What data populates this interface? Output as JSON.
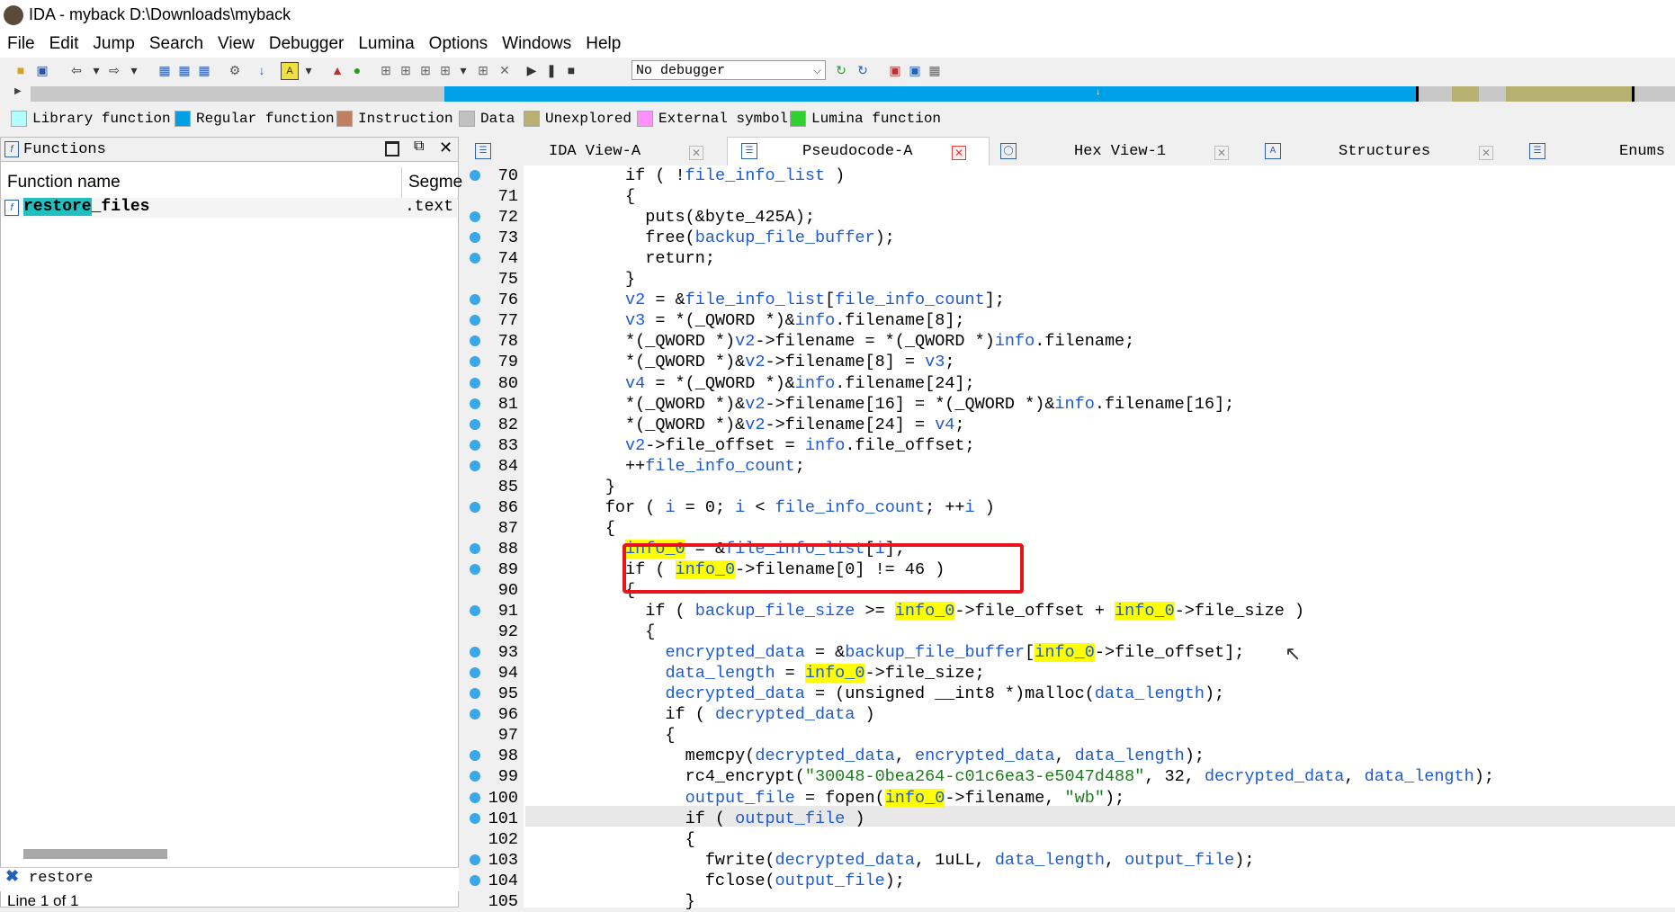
{
  "window": {
    "title": "IDA - myback D:\\Downloads\\myback"
  },
  "menu": [
    "File",
    "Edit",
    "Jump",
    "Search",
    "View",
    "Debugger",
    "Lumina",
    "Options",
    "Windows",
    "Help"
  ],
  "toolbar": {
    "debugger_select": "No debugger"
  },
  "legend": [
    {
      "label": "Library function",
      "color": "#b0ffff"
    },
    {
      "label": "Regular function",
      "color": "#00a0e8"
    },
    {
      "label": "Instruction",
      "color": "#c08060"
    },
    {
      "label": "Data",
      "color": "#c0c0c0"
    },
    {
      "label": "Unexplored",
      "color": "#b8b070"
    },
    {
      "label": "External symbol",
      "color": "#ff90ff"
    },
    {
      "label": "Lumina function",
      "color": "#30d030"
    }
  ],
  "functions_panel": {
    "title": "Functions",
    "col_name": "Function name",
    "col_segment": "Segme",
    "row_name_prefix": "restore",
    "row_name_suffix": "_files",
    "row_segment": ".text",
    "filter_text": "restore",
    "status": "Line 1 of 1"
  },
  "tabs": [
    {
      "label": "IDA View-A"
    },
    {
      "label": "Pseudocode-A"
    },
    {
      "label": "Hex View-1"
    },
    {
      "label": "Structures"
    },
    {
      "label": "Enums"
    }
  ],
  "code_lines": [
    {
      "n": "70",
      "dot": true
    },
    {
      "n": "71",
      "dot": false
    },
    {
      "n": "72",
      "dot": true
    },
    {
      "n": "73",
      "dot": true
    },
    {
      "n": "74",
      "dot": true
    },
    {
      "n": "75",
      "dot": false
    },
    {
      "n": "76",
      "dot": true
    },
    {
      "n": "77",
      "dot": true
    },
    {
      "n": "78",
      "dot": true
    },
    {
      "n": "79",
      "dot": true
    },
    {
      "n": "80",
      "dot": true
    },
    {
      "n": "81",
      "dot": true
    },
    {
      "n": "82",
      "dot": true
    },
    {
      "n": "83",
      "dot": true
    },
    {
      "n": "84",
      "dot": true
    },
    {
      "n": "85",
      "dot": false
    },
    {
      "n": "86",
      "dot": true
    },
    {
      "n": "87",
      "dot": false
    },
    {
      "n": "88",
      "dot": true
    },
    {
      "n": "89",
      "dot": true
    },
    {
      "n": "90",
      "dot": false
    },
    {
      "n": "91",
      "dot": true
    },
    {
      "n": "92",
      "dot": false
    },
    {
      "n": "93",
      "dot": true
    },
    {
      "n": "94",
      "dot": true
    },
    {
      "n": "95",
      "dot": true
    },
    {
      "n": "96",
      "dot": true
    },
    {
      "n": "97",
      "dot": false
    },
    {
      "n": "98",
      "dot": true
    },
    {
      "n": "99",
      "dot": true
    },
    {
      "n": "100",
      "dot": true
    },
    {
      "n": "101",
      "dot": true
    },
    {
      "n": "102",
      "dot": false
    },
    {
      "n": "103",
      "dot": true
    },
    {
      "n": "104",
      "dot": true
    },
    {
      "n": "105",
      "dot": false
    }
  ],
  "code_html": [
    "          if ( !<span class='v'>file_info_list</span> )",
    "          {",
    "            puts(&amp;byte_425A);",
    "            free(<span class='v'>backup_file_buffer</span>);",
    "            return;",
    "          }",
    "          <span class='v'>v2</span> = &amp;<span class='v'>file_info_list</span>[<span class='v'>file_info_count</span>];",
    "          <span class='v'>v3</span> = *(_QWORD *)&amp;<span class='v'>info</span>.filename[8];",
    "          *(_QWORD *)<span class='v'>v2</span>-&gt;filename = *(_QWORD *)<span class='v'>info</span>.filename;",
    "          *(_QWORD *)&amp;<span class='v'>v2</span>-&gt;filename[8] = <span class='v'>v3</span>;",
    "          <span class='v'>v4</span> = *(_QWORD *)&amp;<span class='v'>info</span>.filename[24];",
    "          *(_QWORD *)&amp;<span class='v'>v2</span>-&gt;filename[16] = *(_QWORD *)&amp;<span class='v'>info</span>.filename[16];",
    "          *(_QWORD *)&amp;<span class='v'>v2</span>-&gt;filename[24] = <span class='v'>v4</span>;",
    "          <span class='v'>v2</span>-&gt;file_offset = <span class='v'>info</span>.file_offset;",
    "          ++<span class='v'>file_info_count</span>;",
    "        }",
    "        for ( <span class='v'>i</span> = 0; <span class='v'>i</span> &lt; <span class='v'>file_info_count</span>; ++<span class='v'>i</span> )",
    "        {",
    "          <span class='hl'>info_0</span> = &amp;<span class='v'>file_info_list</span>[<span class='v'>i</span>];",
    "          if ( <span class='hl'>info_0</span>-&gt;filename[0] != 46 )",
    "          {",
    "            if ( <span class='v'>backup_file_size</span> &gt;= <span class='hl'>info_0</span>-&gt;file_offset + <span class='hl'>info_0</span>-&gt;file_size )",
    "            {",
    "              <span class='v'>encrypted_data</span> = &amp;<span class='v'>backup_file_buffer</span>[<span class='hl'>info_0</span>-&gt;file_offset];",
    "              <span class='v'>data_length</span> = <span class='hl'>info_0</span>-&gt;file_size;",
    "              <span class='v'>decrypted_data</span> = (unsigned __int8 *)malloc(<span class='v'>data_length</span>);",
    "              if ( <span class='v'>decrypted_data</span> )",
    "              {",
    "                memcpy(<span class='v'>decrypted_data</span>, <span class='v'>encrypted_data</span>, <span class='v'>data_length</span>);",
    "                rc4_encrypt(<span class='s'>\"30048-0bea264-c01c6ea3-e5047d488\"</span>, 32, <span class='v'>decrypted_data</span>, <span class='v'>data_length</span>);",
    "                <span class='v'>output_file</span> = fopen(<span class='hl'>info_0</span>-&gt;filename, <span class='s'>\"wb\"</span>);",
    "                if ( <span class='v'>output_file</span> )",
    "                {",
    "                  fwrite(<span class='v'>decrypted_data</span>, 1uLL, <span class='v'>data_length</span>, <span class='v'>output_file</span>);",
    "                  fclose(<span class='v'>output_file</span>);",
    "                }"
  ]
}
